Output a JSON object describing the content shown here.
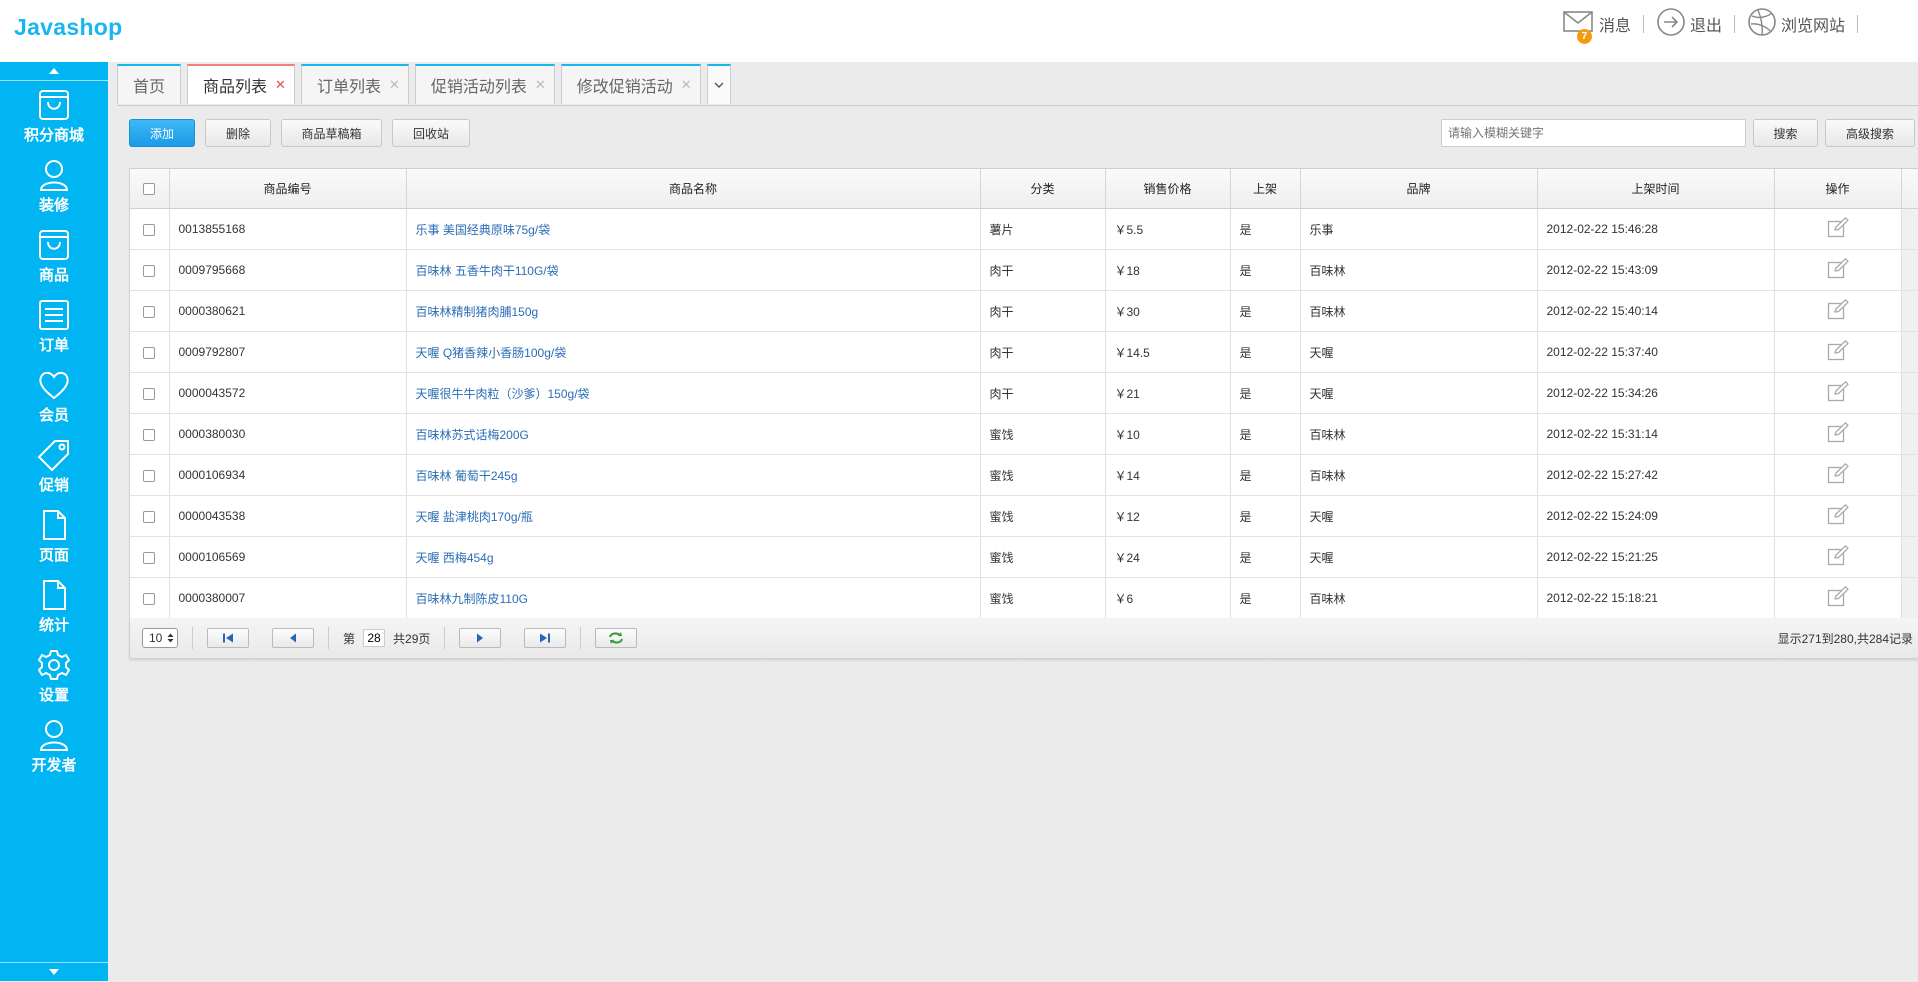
{
  "app": {
    "logo": "Javashop"
  },
  "topbar": {
    "messages_label": "消息",
    "messages_count": "7",
    "logout_label": "退出",
    "browse_label": "浏览网站"
  },
  "sidebar": {
    "items": [
      {
        "label": "积分商城",
        "icon": "shop-bag-icon"
      },
      {
        "label": "装修",
        "icon": "user-icon"
      },
      {
        "label": "商品",
        "icon": "shop-bag-icon"
      },
      {
        "label": "订单",
        "icon": "list-icon"
      },
      {
        "label": "会员",
        "icon": "heart-icon"
      },
      {
        "label": "促销",
        "icon": "tag-icon"
      },
      {
        "label": "页面",
        "icon": "document-icon"
      },
      {
        "label": "统计",
        "icon": "document-icon"
      },
      {
        "label": "设置",
        "icon": "gear-icon"
      },
      {
        "label": "开发者",
        "icon": "user-icon"
      }
    ]
  },
  "tabs": [
    {
      "label": "首页",
      "active": false,
      "closable": false
    },
    {
      "label": "商品列表",
      "active": true,
      "closable": true
    },
    {
      "label": "订单列表",
      "active": false,
      "closable": true
    },
    {
      "label": "促销活动列表",
      "active": false,
      "closable": true
    },
    {
      "label": "修改促销活动",
      "active": false,
      "closable": true
    }
  ],
  "toolbar": {
    "add_label": "添加",
    "delete_label": "删除",
    "drafts_label": "商品草稿箱",
    "recycle_label": "回收站",
    "search_placeholder": "请输入模糊关键字",
    "search_label": "搜索",
    "advanced_search_label": "高级搜索"
  },
  "table": {
    "columns": [
      "商品编号",
      "商品名称",
      "分类",
      "销售价格",
      "上架",
      "品牌",
      "上架时间",
      "操作"
    ],
    "rows": [
      [
        "0013855168",
        "乐事 美国经典原味75g/袋",
        "薯片",
        "￥5.5",
        "是",
        "乐事",
        "2012-02-22 15:46:28"
      ],
      [
        "0009795668",
        "百味林 五香牛肉干110G/袋",
        "肉干",
        "￥18",
        "是",
        "百味林",
        "2012-02-22 15:43:09"
      ],
      [
        "0000380621",
        "百味林精制猪肉脯150g",
        "肉干",
        "￥30",
        "是",
        "百味林",
        "2012-02-22 15:40:14"
      ],
      [
        "0009792807",
        "天喔 Q猪香辣小香肠100g/袋",
        "肉干",
        "￥14.5",
        "是",
        "天喔",
        "2012-02-22 15:37:40"
      ],
      [
        "0000043572",
        "天喔很牛牛肉粒（沙爹）150g/袋",
        "肉干",
        "￥21",
        "是",
        "天喔",
        "2012-02-22 15:34:26"
      ],
      [
        "0000380030",
        "百味林苏式话梅200G",
        "蜜饯",
        "￥10",
        "是",
        "百味林",
        "2012-02-22 15:31:14"
      ],
      [
        "0000106934",
        "百味林 葡萄干245g",
        "蜜饯",
        "￥14",
        "是",
        "百味林",
        "2012-02-22 15:27:42"
      ],
      [
        "0000043538",
        "天喔 盐津桃肉170g/瓶",
        "蜜饯",
        "￥12",
        "是",
        "天喔",
        "2012-02-22 15:24:09"
      ],
      [
        "0000106569",
        "天喔 西梅454g",
        "蜜饯",
        "￥24",
        "是",
        "天喔",
        "2012-02-22 15:21:25"
      ],
      [
        "0000380007",
        "百味林九制陈皮110G",
        "蜜饯",
        "￥6",
        "是",
        "百味林",
        "2012-02-22 15:18:21"
      ]
    ]
  },
  "pager": {
    "page_size": "10",
    "page_prefix": "第",
    "current_page": "28",
    "total_pages_label": "共29页",
    "info": "显示271到280,共284记录"
  },
  "colors": {
    "brand": "#1ab6f0",
    "sidebar": "#00b5f2",
    "link": "#2a6db5",
    "badge": "#f39c12"
  }
}
